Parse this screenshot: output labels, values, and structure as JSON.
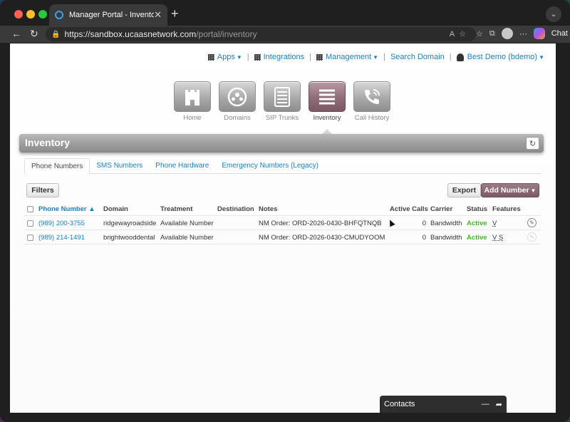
{
  "browser": {
    "tab_title": "Manager Portal - Inventory",
    "tab_close": "✕",
    "new_tab": "+",
    "url_host": "https://sandbox.ucaasnetwork.com",
    "url_path": "/portal/inventory",
    "chat_label": "Chat"
  },
  "topnav": {
    "apps": "Apps",
    "integrations": "Integrations",
    "management": "Management",
    "search_domain": "Search Domain",
    "user": "Best Demo (bdemo)"
  },
  "app_icons": [
    {
      "label": "Home",
      "icon": "castle-icon"
    },
    {
      "label": "Domains",
      "icon": "domains-icon"
    },
    {
      "label": "SIP Trunks",
      "icon": "server-icon"
    },
    {
      "label": "Inventory",
      "icon": "list-icon"
    },
    {
      "label": "Call History",
      "icon": "phone-icon"
    }
  ],
  "inventory": {
    "title": "Inventory"
  },
  "subtabs": [
    "Phone Numbers",
    "SMS Numbers",
    "Phone Hardware",
    "Emergency Numbers (Legacy)"
  ],
  "buttons": {
    "filters": "Filters",
    "export": "Export",
    "add_number": "Add Number"
  },
  "table": {
    "headers": {
      "phone": "Phone Number",
      "domain": "Domain",
      "treatment": "Treatment",
      "destination": "Destination",
      "notes": "Notes",
      "calls": "Active Calls",
      "carrier": "Carrier",
      "status": "Status",
      "features": "Features"
    },
    "rows": [
      {
        "phone": "(989) 200-3755",
        "domain": "ridgewayroadside",
        "treatment": "Available Number",
        "destination": "",
        "notes": "NM Order: ORD-2026-0430-BHFQTNQB",
        "calls": "0",
        "carrier": "Bandwidth",
        "status": "Active",
        "features": "V"
      },
      {
        "phone": "(989) 214-1491",
        "domain": "brightwooddental",
        "treatment": "Available Number",
        "destination": "",
        "notes": "NM Order: ORD-2026-0430-CMUDYOOM",
        "calls": "0",
        "carrier": "Bandwidth",
        "status": "Active",
        "features": "V S"
      }
    ]
  },
  "contacts": {
    "title": "Contacts"
  },
  "colors": {
    "link": "#1a7fc1",
    "status_active": "#3dbb1f",
    "accent_mauve": "#7b5a67"
  }
}
